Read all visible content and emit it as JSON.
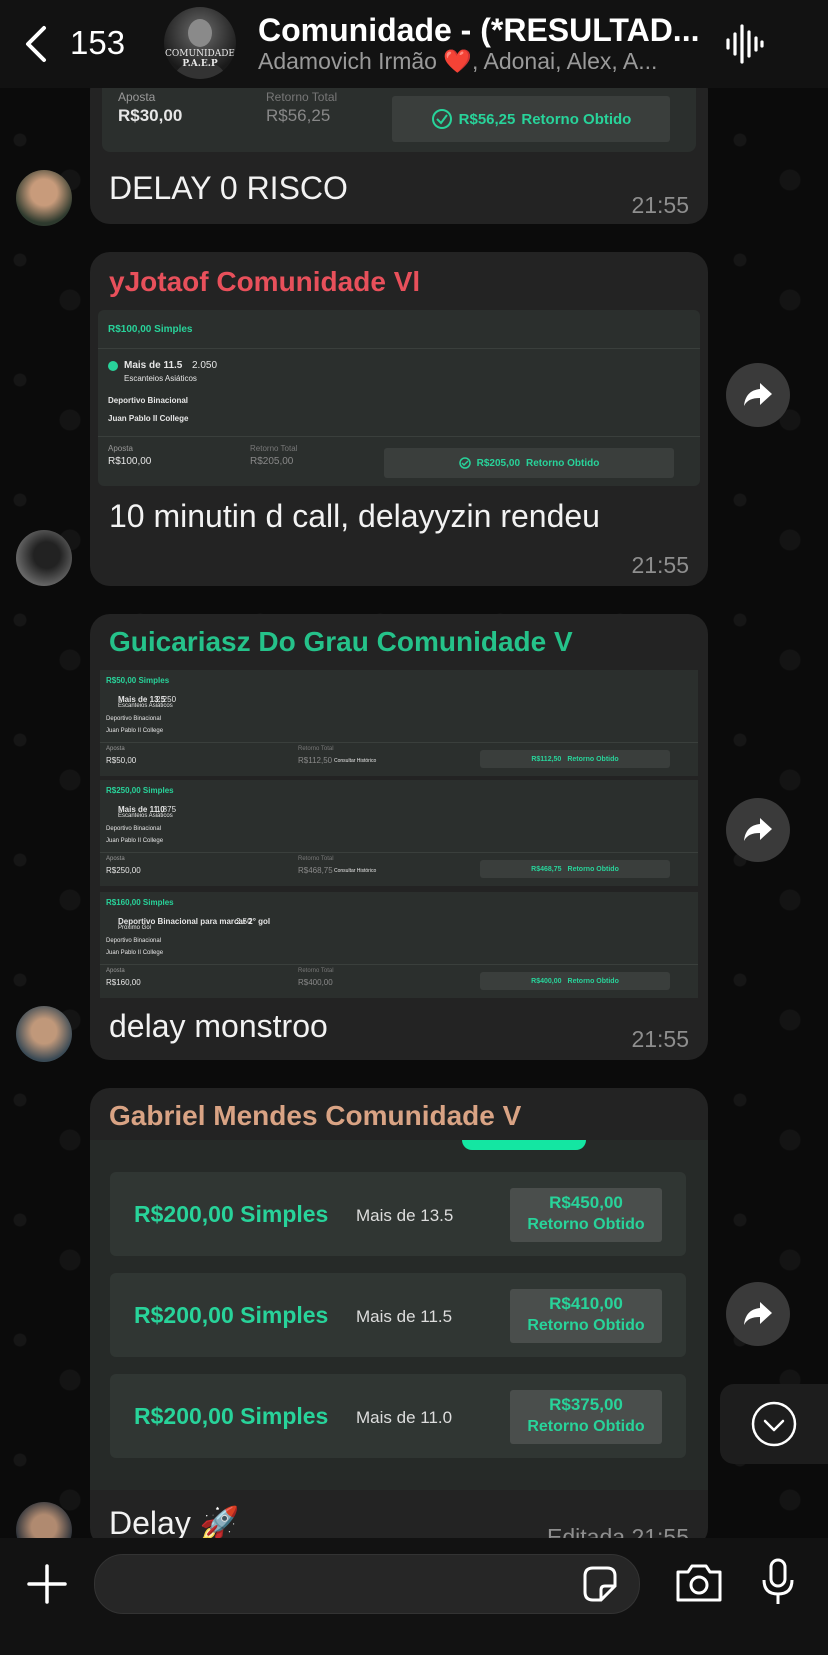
{
  "header": {
    "back_count": "153",
    "title": "Comunidade - (*RESULTAD...",
    "subtitle": "Adamovich Irmão ❤️, Adonai, Alex, A...",
    "avatar_caption_1": "COMUNIDADE",
    "avatar_caption_2": "P.A.E.P"
  },
  "messages": [
    {
      "text": "DELAY 0 RISCO",
      "time": "21:55",
      "bet": {
        "aposta_label": "Aposta",
        "aposta": "R$30,00",
        "retorno_label": "Retorno Total",
        "retorno": "R$56,25",
        "obtido": "R$56,25",
        "obtido_label": "Retorno Obtido"
      }
    },
    {
      "sender": "yJotaof Comunidade Vl",
      "sender_color": "#e8505b",
      "text": "10 minutin d call, delayyzin rendeu",
      "time": "21:55",
      "bet": {
        "stake": "R$100,00 Simples",
        "pick": "Mais de 11.5",
        "odds": "2.050",
        "market": "Escanteios Asiáticos",
        "team1": "Deportivo Binacional",
        "team2": "Juan Pablo II College",
        "aposta_label": "Aposta",
        "aposta": "R$100,00",
        "retorno_label": "Retorno Total",
        "retorno": "R$205,00",
        "obtido": "R$205,00",
        "obtido_label": "Retorno Obtido"
      }
    },
    {
      "sender": "Guicariasz Do Grau Comunidade V",
      "sender_color": "#25c28a",
      "text": "delay monstroo",
      "time": "21:55",
      "bets": [
        {
          "stake": "R$50,00 Simples",
          "pick": "Mais de 13.5",
          "odds": "2.250",
          "market": "Escanteios Asiáticos",
          "team1": "Deportivo Binacional",
          "team2": "Juan Pablo II College",
          "aposta_label": "Aposta",
          "aposta": "R$50,00",
          "retorno_label": "Retorno Total",
          "retorno": "R$112,50",
          "hist": "Consultar Histórico",
          "obtido": "R$112,50",
          "obtido_label": "Retorno Obtido"
        },
        {
          "stake": "R$250,00 Simples",
          "pick": "Mais de 11.0",
          "odds": "1.875",
          "market": "Escanteios Asiáticos",
          "team1": "Deportivo Binacional",
          "team2": "Juan Pablo II College",
          "aposta_label": "Aposta",
          "aposta": "R$250,00",
          "retorno_label": "Retorno Total",
          "retorno": "R$468,75",
          "hist": "Consultar Histórico",
          "obtido": "R$468,75",
          "obtido_label": "Retorno Obtido"
        },
        {
          "stake": "R$160,00 Simples",
          "pick": "Deportivo Binacional para marcar 2° gol",
          "odds": "2.50",
          "market": "Próximo Gol",
          "team1": "Deportivo Binacional",
          "team2": "Juan Pablo II College",
          "aposta_label": "Aposta",
          "aposta": "R$160,00",
          "retorno_label": "Retorno Total",
          "retorno": "R$400,00",
          "hist": "",
          "obtido": "R$400,00",
          "obtido_label": "Retorno Obtido"
        }
      ]
    },
    {
      "sender": "Gabriel Mendes Comunidade V",
      "sender_color": "#d9a384",
      "text": "Delay 🚀",
      "time": "Editada 21:55",
      "cards": [
        {
          "stake": "R$200,00 Simples",
          "pick": "Mais de 13.5",
          "amount": "R$450,00",
          "label": "Retorno Obtido"
        },
        {
          "stake": "R$200,00 Simples",
          "pick": "Mais de 11.5",
          "amount": "R$410,00",
          "label": "Retorno Obtido"
        },
        {
          "stake": "R$200,00 Simples",
          "pick": "Mais de 11.0",
          "amount": "R$375,00",
          "label": "Retorno Obtido"
        }
      ]
    }
  ],
  "colors": {
    "accent_green": "#28d39a",
    "bubble": "#232323",
    "background": "#0b0b0b"
  },
  "icons": [
    "chevron-left-icon",
    "voice-call-icon",
    "forward-icon",
    "scroll-down-icon",
    "plus-icon",
    "sticker-icon",
    "camera-icon",
    "microphone-icon",
    "check-circle-icon",
    "rocket-emoji"
  ]
}
